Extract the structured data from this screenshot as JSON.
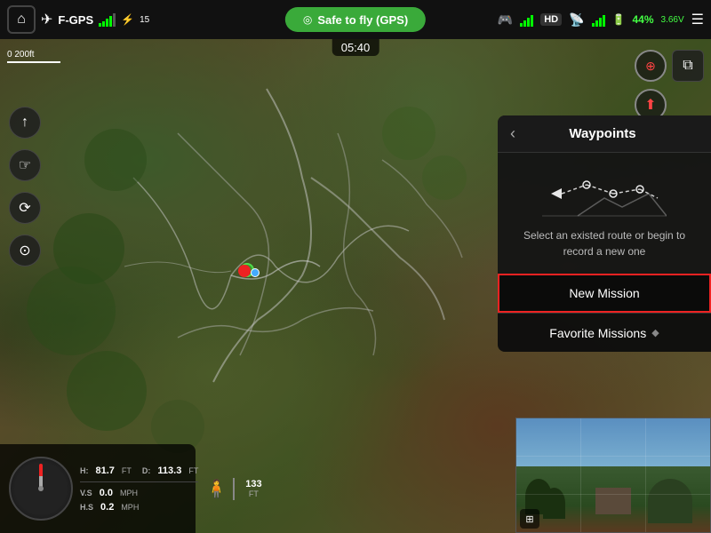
{
  "topbar": {
    "home_icon": "🏠",
    "drone_icon": "✈",
    "gps_name": "F-GPS",
    "signal_bars": [
      4,
      7,
      10,
      13,
      16
    ],
    "link_icon": "⚡",
    "safe_to_fly": "Safe to fly (GPS)",
    "video_quality": "HD",
    "battery_percent": "44%",
    "battery_voltage": "3.66V",
    "menu_icon": "☰"
  },
  "timer": {
    "value": "05:40"
  },
  "scale": {
    "label": "0     200ft"
  },
  "hud": {
    "h_label": "H:",
    "h_value": "81.7",
    "h_unit": "FT",
    "d_label": "D:",
    "d_value": "113.3",
    "d_unit": "FT",
    "vs_label": "V.S",
    "vs_value": "0.0",
    "vs_unit": "MPH",
    "hs_label": "H.S",
    "hs_value": "0.2",
    "hs_unit": "MPH",
    "alt_value": "133",
    "alt_unit": "FT"
  },
  "waypoints_panel": {
    "back_label": "‹",
    "title": "Waypoints",
    "description": "Select an existed route or begin to record a new one",
    "new_mission_label": "New Mission",
    "favorite_missions_label": "Favorite Missions"
  }
}
